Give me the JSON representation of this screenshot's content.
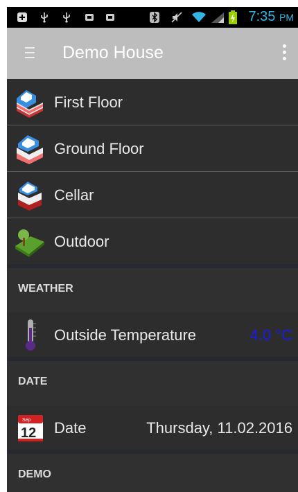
{
  "status_bar": {
    "time": "7:35",
    "ampm": "PM",
    "icons": [
      "notification-icon",
      "usb-icon",
      "usb-icon",
      "app-icon",
      "app-icon",
      "bluetooth-icon",
      "mute-icon",
      "wifi-icon",
      "signal-icon",
      "battery-charging-icon"
    ]
  },
  "action_bar": {
    "title": "Demo House"
  },
  "floors": [
    {
      "label": "First Floor",
      "icon": "first-floor-icon"
    },
    {
      "label": "Ground Floor",
      "icon": "ground-floor-icon"
    },
    {
      "label": "Cellar",
      "icon": "cellar-icon"
    },
    {
      "label": "Outdoor",
      "icon": "outdoor-icon"
    }
  ],
  "sections": {
    "weather": {
      "title": "WEATHER",
      "item_label": "Outside Temperature",
      "item_value": "4.0 °C",
      "value_color": "#1a1ae6",
      "icon": "thermometer-icon"
    },
    "date": {
      "title": "DATE",
      "item_label": "Date",
      "item_value": "Thursday, 11.02.2016",
      "icon": "calendar-icon",
      "calendar_day": "12",
      "calendar_month": "Sep"
    },
    "demo": {
      "title": "DEMO"
    }
  },
  "colors": {
    "accent": "#33b5e5",
    "action_bar": "#bdbdbd",
    "background": "#2d2d2d"
  }
}
